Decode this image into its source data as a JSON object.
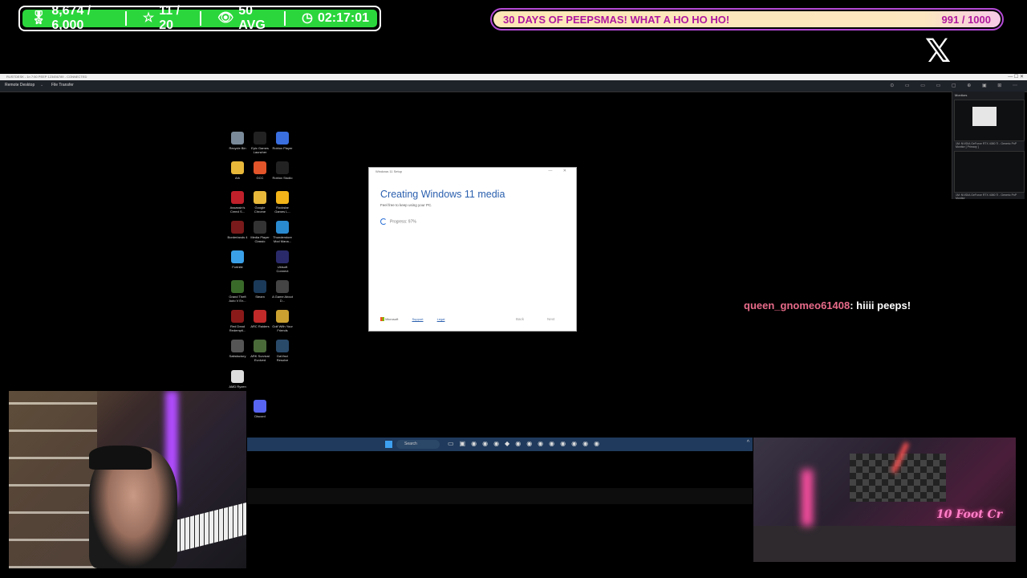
{
  "stats": {
    "points": "8,674 / 6,000",
    "stars": "11 / 20",
    "viewers": "50 AVG",
    "uptime": "02:17:01"
  },
  "goal": {
    "title": "30 DAYS OF PEEPSMAS! WHAT A HO HO HO!",
    "progress": "991 / 1000",
    "fraction": 0.991
  },
  "remote_desktop": {
    "title": "RUSTDESK - 1n 7:50 PEEP 123456789 - CONNECTED",
    "menu": [
      "Remote Desktop",
      "File Transfer"
    ],
    "monitors_title": "Monitors",
    "monitor_captions": [
      "1M: NVIDIA GeForce RTX 4080 Ti - Generic PnP Monitor [ Primary ]",
      "1M: NVIDIA GeForce RTX 4080 Ti - Generic PnP Monitor"
    ]
  },
  "desktop_icons": [
    {
      "label": "Recycle Bin",
      "icon": "recycle-bin-icon",
      "color": "#7a8a99"
    },
    {
      "label": "Epic Games Launcher",
      "icon": "epic-games-icon",
      "color": "#222222"
    },
    {
      "label": "Roblox Player",
      "icon": "roblox-icon",
      "color": "#3a6fe0"
    },
    {
      "label": "Ark",
      "icon": "folder-icon",
      "color": "#e8b83a"
    },
    {
      "label": "GCC",
      "icon": "gcc-icon",
      "color": "#e2542a"
    },
    {
      "label": "Roblox Studio",
      "icon": "roblox-studio-icon",
      "color": "#222222"
    },
    {
      "label": "Assassin's Creed S...",
      "icon": "assassins-creed-icon",
      "color": "#c0202a"
    },
    {
      "label": "Google Chrome",
      "icon": "chrome-icon",
      "color": "#e8b83a"
    },
    {
      "label": "Rockstar Games L...",
      "icon": "rockstar-icon",
      "color": "#f2b418"
    },
    {
      "label": "Borderlands 4",
      "icon": "borderlands-icon",
      "color": "#7a1a1a"
    },
    {
      "label": "Media Player Classic",
      "icon": "media-player-icon",
      "color": "#333333"
    },
    {
      "label": "Thunderstore Mod Mana...",
      "icon": "thunderstore-icon",
      "color": "#2a8ad0"
    },
    {
      "label": "Fortnite",
      "icon": "fortnite-icon",
      "color": "#3aa0e8"
    },
    {
      "label": "",
      "icon": "",
      "color": ""
    },
    {
      "label": "Ubisoft Connect",
      "icon": "ubisoft-icon",
      "color": "#2a2a6a"
    },
    {
      "label": "Grand Theft Auto V En...",
      "icon": "gta-icon",
      "color": "#3a6a2a"
    },
    {
      "label": "Steam",
      "icon": "steam-icon",
      "color": "#1b3a5a"
    },
    {
      "label": "A Game About D...",
      "icon": "game-about-icon",
      "color": "#444444"
    },
    {
      "label": "Red Dead Redempti...",
      "icon": "red-dead-icon",
      "color": "#8a1a1a"
    },
    {
      "label": "ARC Raiders",
      "icon": "arc-raiders-icon",
      "color": "#c22a2a"
    },
    {
      "label": "Golf With Your Friends",
      "icon": "golf-icon",
      "color": "#caa030"
    },
    {
      "label": "Satisfactory",
      "icon": "satisfactory-icon",
      "color": "#555555"
    },
    {
      "label": "ARK Survival Evolved",
      "icon": "ark-survival-icon",
      "color": "#4a6a3a"
    },
    {
      "label": "DaVinci Resolve",
      "icon": "davinci-icon",
      "color": "#2a4a6a"
    },
    {
      "label": "AMD Ryzen",
      "icon": "amd-ryzen-icon",
      "color": "#dddddd"
    },
    {
      "label": "Discord",
      "icon": "discord-icon",
      "color": "#5865f2"
    }
  ],
  "setup_dialog": {
    "window_title": "Windows 11 Setup",
    "heading": "Creating Windows 11 media",
    "subtext": "Feel free to keep using your PC.",
    "progress_text": "Progress: 97%",
    "brand": "Microsoft",
    "link1": "Support",
    "link2": "Legal",
    "back_label": "Back",
    "next_label": "Next"
  },
  "chat": {
    "user": "queen_gnomeo61408",
    "message": ": hiiii peeps!",
    "user_color": "#e86b8a"
  },
  "taskbar": {
    "search_label": "Search",
    "tray_caret": "^"
  }
}
